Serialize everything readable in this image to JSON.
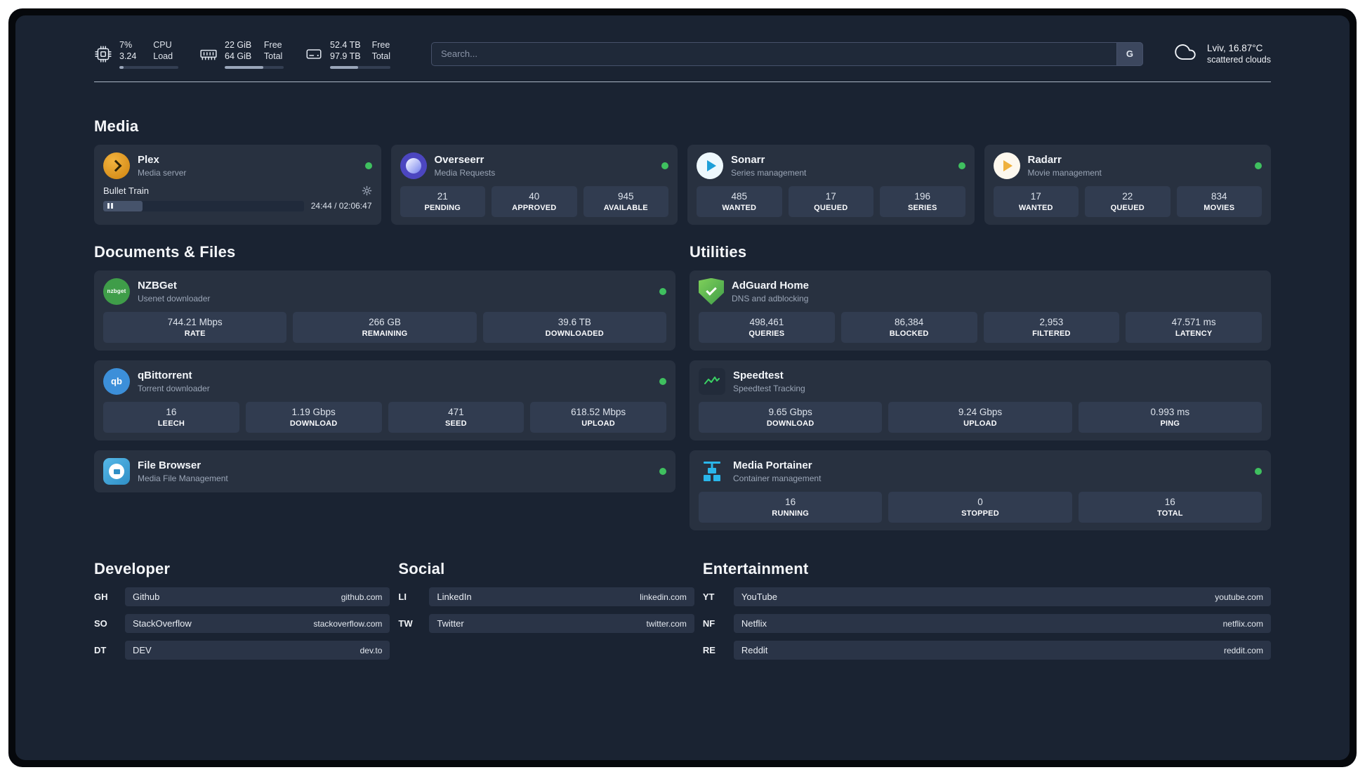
{
  "colors": {
    "background": "#1a2332",
    "card": "#283140",
    "stat_box": "#313c50",
    "status_online": "#3fc05f",
    "plex_brand": "#e5a00d",
    "overseerr_brand": "#4c46c0",
    "sonarr_brand": "#1e9fd8",
    "radarr_brand": "#efb13e",
    "nzbget_brand": "#3f9d49",
    "qbittorrent_brand": "#3c8fd9",
    "filebrowser_brand": "#2f8fc6",
    "adguard_brand": "#5cb85c",
    "speedtest_brand": "#3ad164",
    "portainer_brand": "#2ab6ea"
  },
  "header": {
    "metrics": [
      {
        "icon": "cpu-icon",
        "values": [
          "7%",
          "3.24"
        ],
        "labels": [
          "CPU",
          "Load"
        ],
        "progress_pct": 7
      },
      {
        "icon": "ram-icon",
        "values": [
          "22 GiB",
          "64 GiB"
        ],
        "labels": [
          "Free",
          "Total"
        ],
        "progress_pct": 66
      },
      {
        "icon": "disk-icon",
        "values": [
          "52.4 TB",
          "97.9 TB"
        ],
        "labels": [
          "Free",
          "Total"
        ],
        "progress_pct": 46
      }
    ],
    "search": {
      "placeholder": "Search...",
      "engine_button": "G"
    },
    "weather": {
      "icon": "cloud-icon",
      "location": "Lviv, 16.87°C",
      "condition": "scattered clouds"
    }
  },
  "media": {
    "title": "Media",
    "plex": {
      "title": "Plex",
      "subtitle": "Media server",
      "icon": "plex-icon",
      "status": "online",
      "player": {
        "track": "Bullet Train",
        "time": "24:44 / 02:06:47",
        "progress_pct": 19.5,
        "state": "paused"
      }
    },
    "overseerr": {
      "title": "Overseerr",
      "subtitle": "Media Requests",
      "icon": "overseerr-icon",
      "status": "online",
      "stats": [
        {
          "value": "21",
          "label": "PENDING"
        },
        {
          "value": "40",
          "label": "APPROVED"
        },
        {
          "value": "945",
          "label": "AVAILABLE"
        }
      ]
    },
    "sonarr": {
      "title": "Sonarr",
      "subtitle": "Series management",
      "icon": "sonarr-icon",
      "status": "online",
      "stats": [
        {
          "value": "485",
          "label": "WANTED"
        },
        {
          "value": "17",
          "label": "QUEUED"
        },
        {
          "value": "196",
          "label": "SERIES"
        }
      ]
    },
    "radarr": {
      "title": "Radarr",
      "subtitle": "Movie management",
      "icon": "radarr-icon",
      "status": "online",
      "stats": [
        {
          "value": "17",
          "label": "WANTED"
        },
        {
          "value": "22",
          "label": "QUEUED"
        },
        {
          "value": "834",
          "label": "MOVIES"
        }
      ]
    }
  },
  "documents": {
    "title": "Documents & Files",
    "nzbget": {
      "title": "NZBGet",
      "subtitle": "Usenet downloader",
      "icon": "nzbget-icon",
      "icon_text": "nzbget",
      "status": "online",
      "stats": [
        {
          "value": "744.21 Mbps",
          "label": "RATE"
        },
        {
          "value": "266 GB",
          "label": "REMAINING"
        },
        {
          "value": "39.6 TB",
          "label": "DOWNLOADED"
        }
      ]
    },
    "qbittorrent": {
      "title": "qBittorrent",
      "subtitle": "Torrent downloader",
      "icon": "qbittorrent-icon",
      "icon_text": "qb",
      "status": "online",
      "stats": [
        {
          "value": "16",
          "label": "LEECH"
        },
        {
          "value": "1.19 Gbps",
          "label": "DOWNLOAD"
        },
        {
          "value": "471",
          "label": "SEED"
        },
        {
          "value": "618.52 Mbps",
          "label": "UPLOAD"
        }
      ]
    },
    "filebrowser": {
      "title": "File Browser",
      "subtitle": "Media File Management",
      "icon": "filebrowser-icon",
      "status": "online"
    }
  },
  "utilities": {
    "title": "Utilities",
    "adguard": {
      "title": "AdGuard Home",
      "subtitle": "DNS and adblocking",
      "icon": "adguard-icon",
      "stats": [
        {
          "value": "498,461",
          "label": "QUERIES"
        },
        {
          "value": "86,384",
          "label": "BLOCKED"
        },
        {
          "value": "2,953",
          "label": "FILTERED"
        },
        {
          "value": "47.571 ms",
          "label": "LATENCY"
        }
      ]
    },
    "speedtest": {
      "title": "Speedtest",
      "subtitle": "Speedtest Tracking",
      "icon": "speedtest-icon",
      "stats": [
        {
          "value": "9.65 Gbps",
          "label": "DOWNLOAD"
        },
        {
          "value": "9.24 Gbps",
          "label": "UPLOAD"
        },
        {
          "value": "0.993 ms",
          "label": "PING"
        }
      ]
    },
    "portainer": {
      "title": "Media Portainer",
      "subtitle": "Container management",
      "icon": "portainer-icon",
      "status": "online",
      "stats": [
        {
          "value": "16",
          "label": "RUNNING"
        },
        {
          "value": "0",
          "label": "STOPPED"
        },
        {
          "value": "16",
          "label": "TOTAL"
        }
      ]
    }
  },
  "bookmarks": {
    "developer": {
      "title": "Developer",
      "items": [
        {
          "abbr": "GH",
          "name": "Github",
          "url": "github.com"
        },
        {
          "abbr": "SO",
          "name": "StackOverflow",
          "url": "stackoverflow.com"
        },
        {
          "abbr": "DT",
          "name": "DEV",
          "url": "dev.to"
        }
      ]
    },
    "social": {
      "title": "Social",
      "items": [
        {
          "abbr": "LI",
          "name": "LinkedIn",
          "url": "linkedin.com"
        },
        {
          "abbr": "TW",
          "name": "Twitter",
          "url": "twitter.com"
        }
      ]
    },
    "entertainment": {
      "title": "Entertainment",
      "items": [
        {
          "abbr": "YT",
          "name": "YouTube",
          "url": "youtube.com"
        },
        {
          "abbr": "NF",
          "name": "Netflix",
          "url": "netflix.com"
        },
        {
          "abbr": "RE",
          "name": "Reddit",
          "url": "reddit.com"
        }
      ]
    }
  }
}
